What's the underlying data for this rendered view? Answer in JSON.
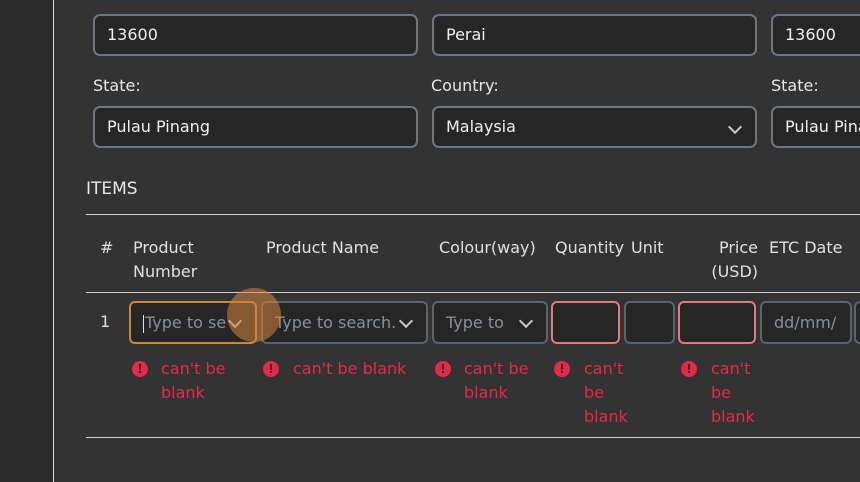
{
  "top_row": {
    "postcode_1": "13600",
    "city_1": "Perai",
    "postcode_2": "13600"
  },
  "address": {
    "state_label": "State:",
    "state_value": "Pulau Pinang",
    "country_label": "Country:",
    "country_value": "Malaysia",
    "state_label_2": "State:",
    "state_value_2": "Pulau Pina"
  },
  "items": {
    "section_title": "ITEMS",
    "headers": {
      "num": "#",
      "product_number_line1": "Product",
      "product_number_line2": "Number",
      "product_name": "Product Name",
      "colourway": "Colour(way)",
      "quantity": "Quantity",
      "unit": "Unit",
      "price_line1": "Price",
      "price_line2": "(USD)",
      "etc_date": "ETC Date"
    },
    "row": {
      "num": "1",
      "product_number_placeholder": "Type to se",
      "product_name_placeholder": "Type to search.",
      "colourway_placeholder": "Type to",
      "etc_date_placeholder": "dd/mm/"
    },
    "errors": {
      "product_number": [
        "can't be",
        "blank"
      ],
      "product_name": "can't be blank",
      "colourway": [
        "can't be",
        "blank"
      ],
      "quantity": [
        "can't",
        "be",
        "blank"
      ],
      "price": [
        "can't",
        "be",
        "blank"
      ]
    }
  }
}
